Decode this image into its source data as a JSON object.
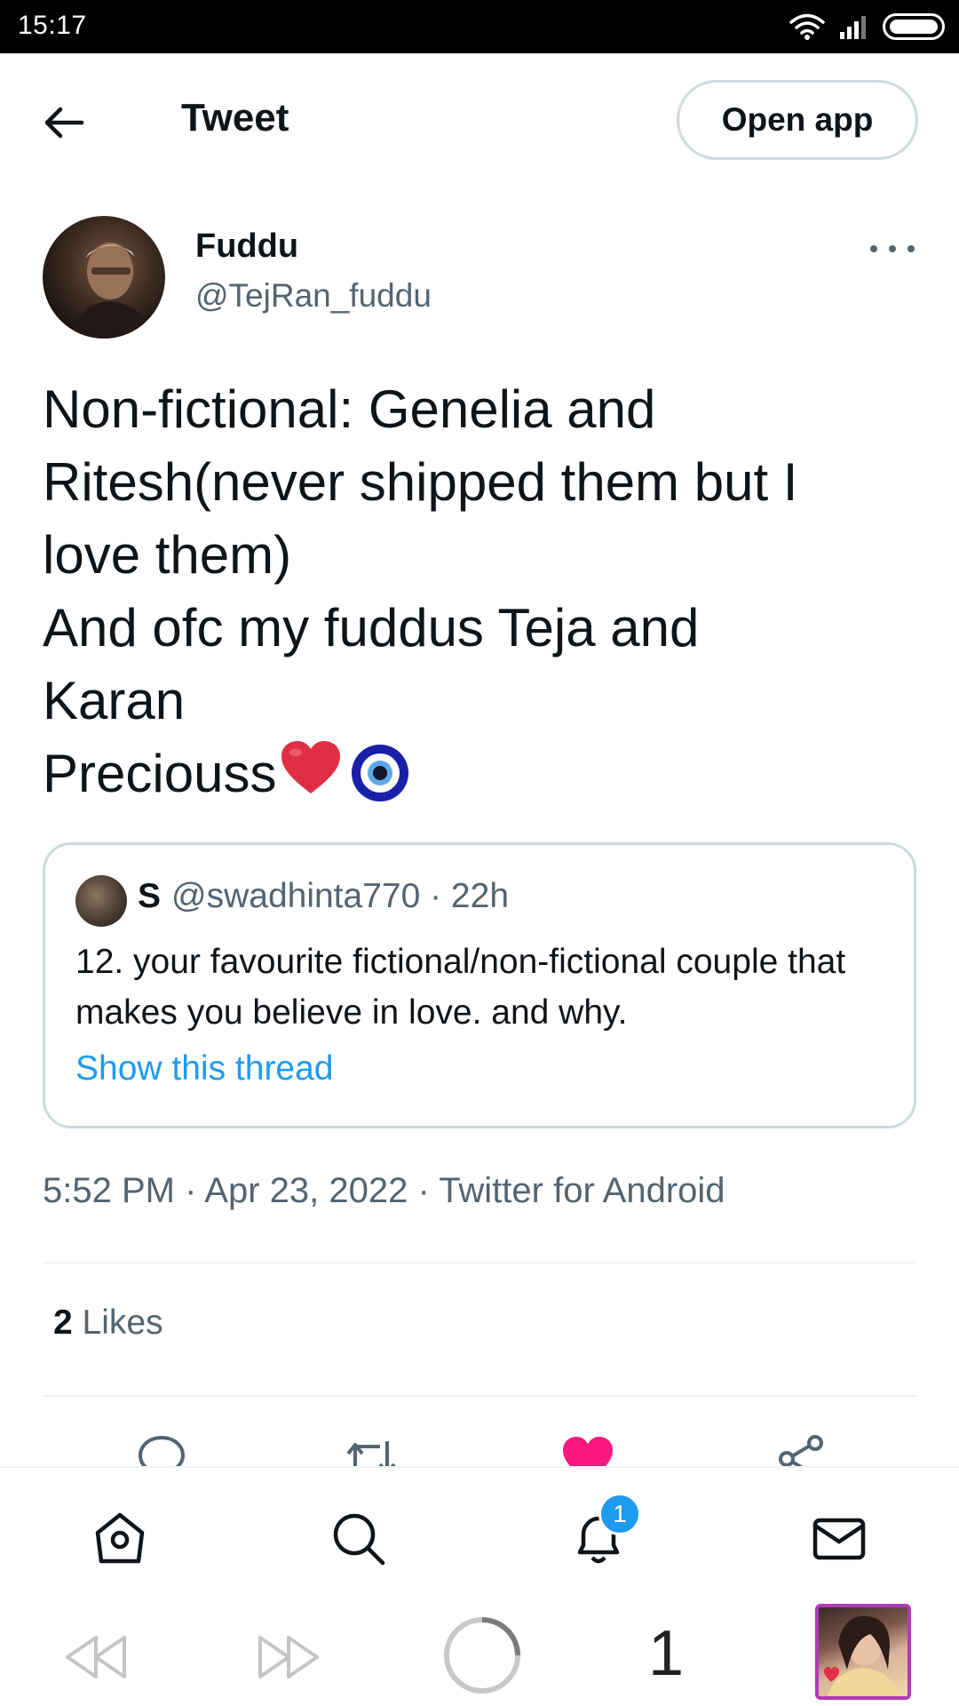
{
  "status_bar": {
    "time": "15:17"
  },
  "header": {
    "title": "Tweet",
    "open_app_label": "Open app"
  },
  "author": {
    "name": "Fuddu",
    "handle": "@TejRan_fuddu"
  },
  "tweet": {
    "lines": [
      "Non-fictional: Genelia and",
      "Ritesh(never shipped them but I",
      "love them)",
      "And ofc my fuddus Teja and",
      "Karan",
      "Preciouss"
    ],
    "emojis": [
      "red-heart",
      "nazar-amulet"
    ]
  },
  "quote": {
    "name": "S",
    "meta": "@swadhinta770 · 22h",
    "text": "12. your favourite fictional/non-fictional couple that makes you believe in love. and why.",
    "link": "Show this thread"
  },
  "timestamp": "5:52 PM · Apr 23, 2022 · Twitter for Android",
  "likes": {
    "count": "2",
    "label": "Likes"
  },
  "actions": [
    "reply-icon",
    "retweet-icon",
    "like-icon",
    "share-icon"
  ],
  "colors": {
    "accent": "#1d9bf0",
    "like": "#f91880",
    "muted": "#536471",
    "border": "#cfd9de"
  },
  "bottom_nav": {
    "notification_badge": "1"
  },
  "browser": {
    "tab_count": "1"
  }
}
